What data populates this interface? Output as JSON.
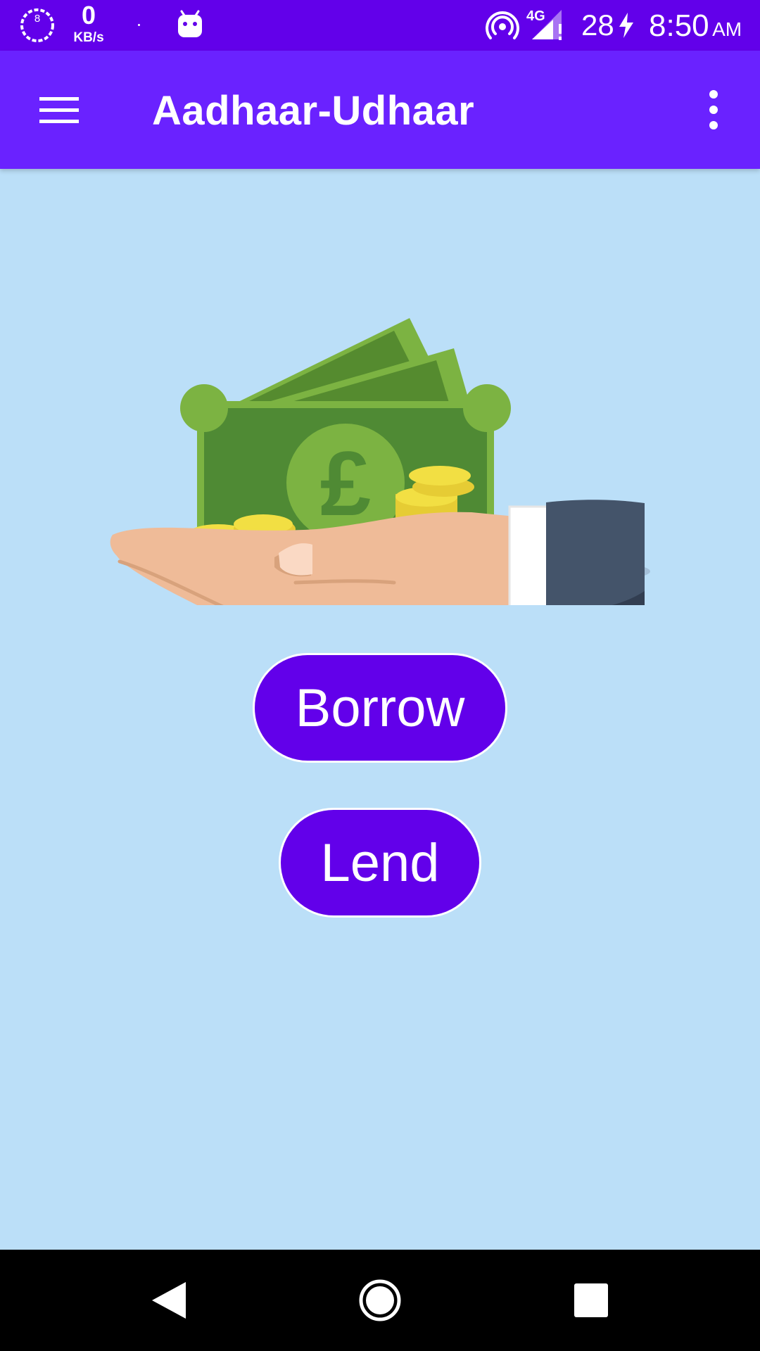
{
  "status_bar": {
    "badge_number": "8",
    "speed_value": "0",
    "speed_unit": "KB/s",
    "network_type": "4G",
    "battery_level": "28",
    "time": "8:50",
    "time_suffix": "AM"
  },
  "app_bar": {
    "title": "Aadhaar-Udhaar"
  },
  "hero": {
    "currency_symbol": "£"
  },
  "actions": {
    "borrow_label": "Borrow",
    "lend_label": "Lend"
  },
  "colors": {
    "status_bar": "#6200ea",
    "app_bar": "#6a22ff",
    "background": "#bbdff8",
    "button": "#6200ea"
  },
  "icons": [
    "notification-badge-icon",
    "android-icon",
    "hotspot-icon",
    "signal-icon",
    "charging-icon",
    "menu-icon",
    "more-vert-icon",
    "back-icon",
    "home-icon",
    "recents-icon"
  ]
}
